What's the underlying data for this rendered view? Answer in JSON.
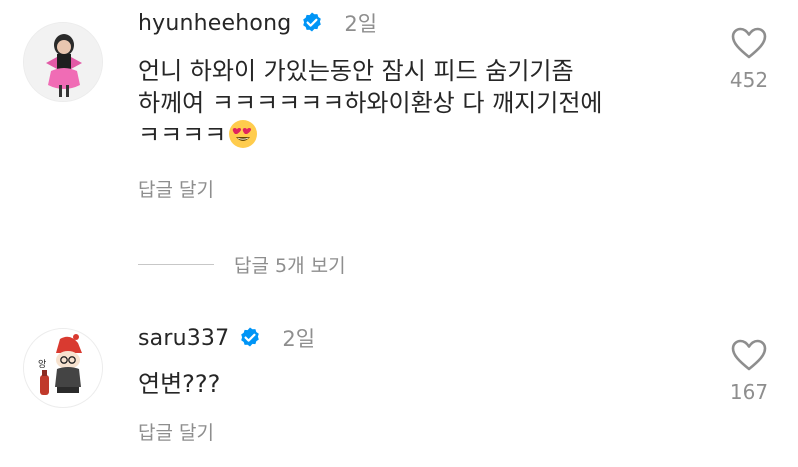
{
  "comments": [
    {
      "username": "hyunheehong",
      "verified": true,
      "time": "2일",
      "text_lines": [
        "언니 하와이 가있는동안 잠시 피드 숨기기좀",
        "하께여 ㅋㅋㅋㅋㅋㅋ하와이환상 다 깨지기전에",
        "ㅋㅋㅋㅋ"
      ],
      "emoji": "heart-eyes-emoji",
      "reply_label": "답글 달기",
      "like_count": "452"
    },
    {
      "username": "saru337",
      "verified": true,
      "time": "2일",
      "text_lines": [
        "연변???"
      ],
      "reply_label": "답글 달기",
      "like_count": "167"
    }
  ],
  "view_replies_label": "답글 5개 보기",
  "icons": {
    "verified": "verified-badge-icon",
    "like": "heart-outline-icon"
  },
  "colors": {
    "verified": "#0095f6",
    "secondary_text": "#8e8e8e",
    "primary_text": "#262626"
  }
}
